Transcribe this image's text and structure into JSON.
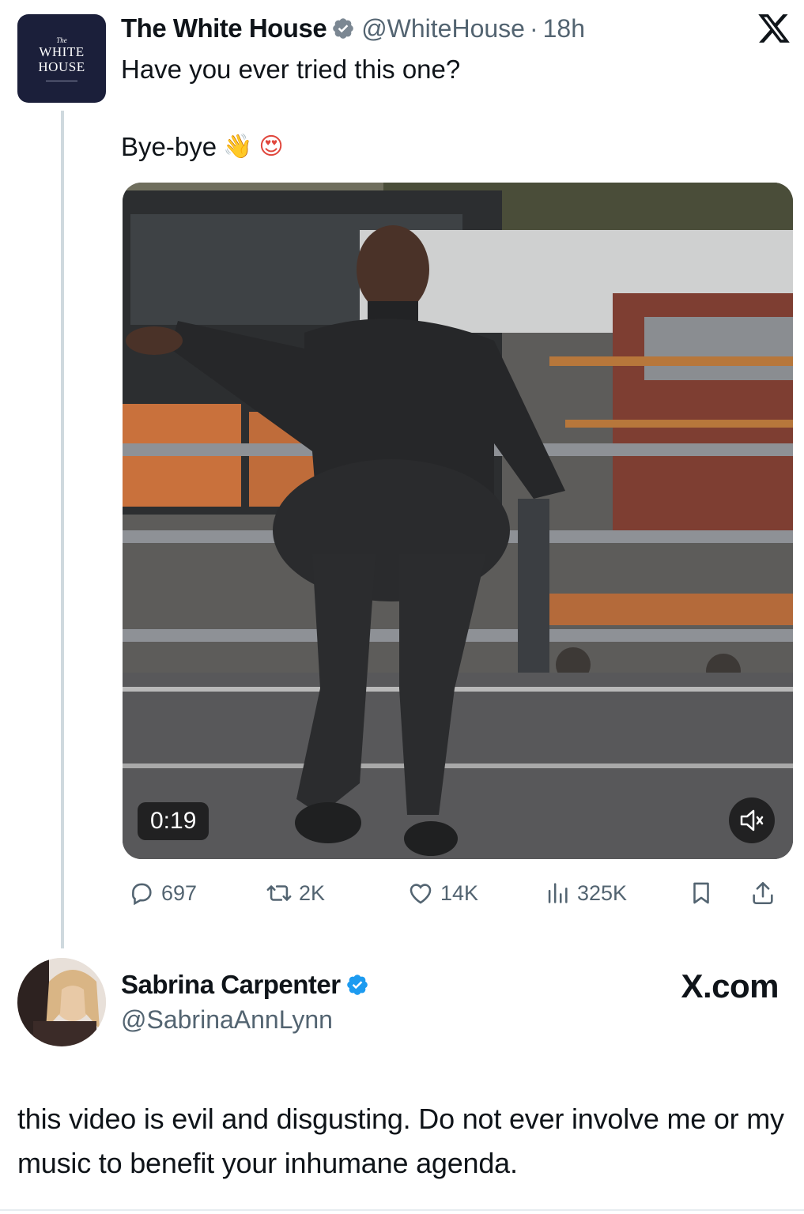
{
  "post": {
    "author": {
      "avatar_lines": [
        "The",
        "WHITE",
        "HOUSE"
      ],
      "display_name": "The White House",
      "verified_badge": "verified-badge",
      "handle": "@WhiteHouse",
      "separator": "·",
      "time": "18h"
    },
    "text_line1": "Have you ever tried this one?",
    "text_line2": "Bye-bye",
    "emojis": [
      "👋",
      "😍"
    ],
    "media": {
      "type": "video",
      "description_icon": "video-thumbnail",
      "duration": "0:19",
      "mute_icon": "volume-muted-icon"
    },
    "actions": {
      "replies": "697",
      "reposts": "2K",
      "likes": "14K",
      "views": "325K"
    }
  },
  "reply": {
    "display_name": "Sabrina Carpenter",
    "verified_badge": "verified-badge",
    "handle": "@SabrinaAnnLynn",
    "source": "X.com",
    "text": "this video is evil and disgusting. Do not ever involve me or my music to benefit your inhumane agenda."
  },
  "colors": {
    "verified_blue": "#1d9bf0",
    "secondary_text": "#536471",
    "avatar_navy": "#1b1f3a"
  }
}
